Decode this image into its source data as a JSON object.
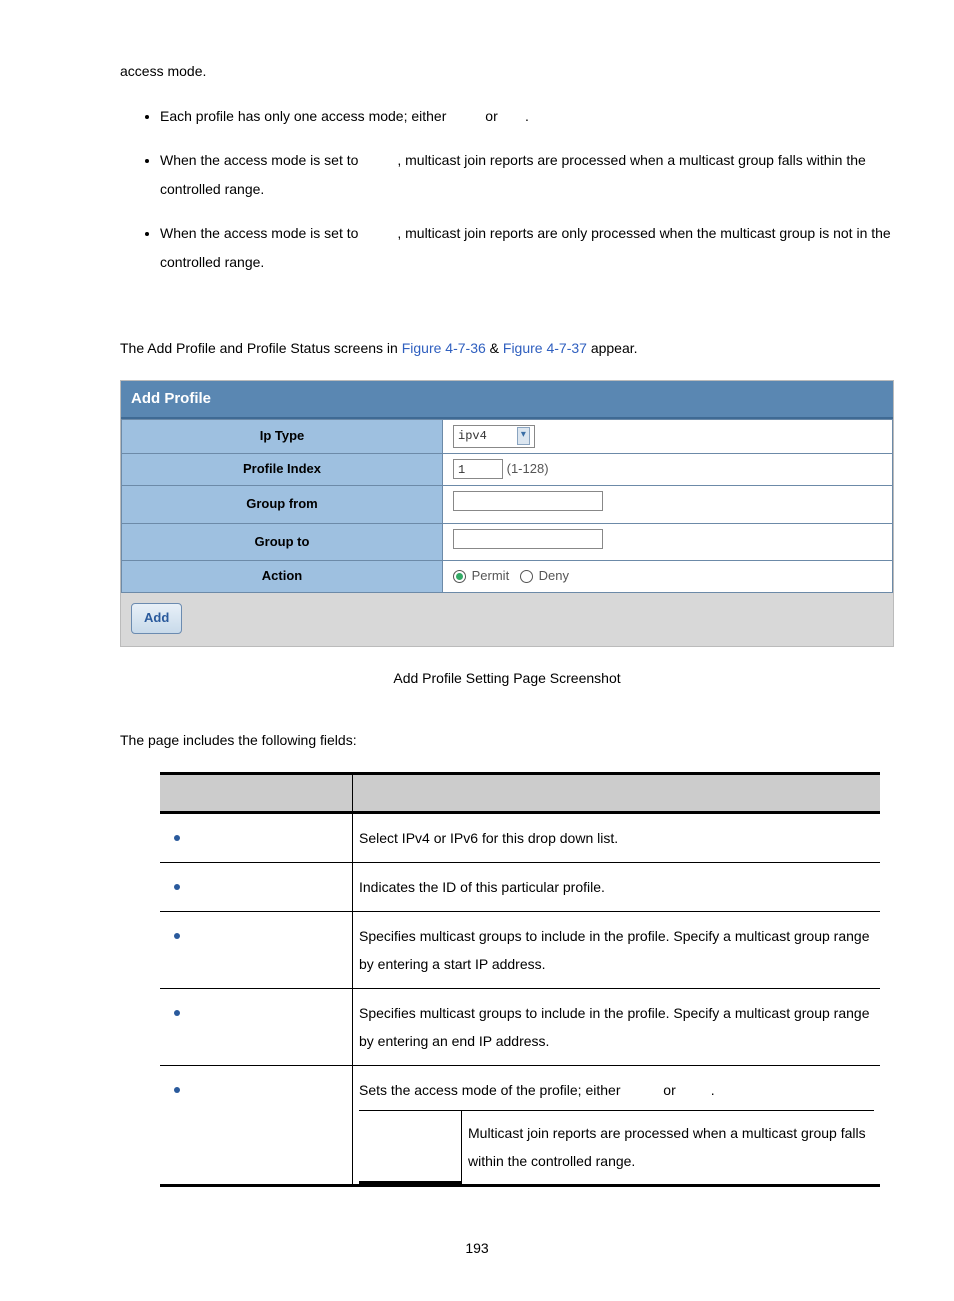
{
  "intro": {
    "line1": "access mode."
  },
  "bullets": {
    "b1_pre": "Each profile has only one access mode; either ",
    "b1_mid": "or",
    "b1_post": ".",
    "b2_pre": "When the access mode is set to ",
    "b2_post": ", multicast join reports are processed when a multicast group falls within the controlled range.",
    "b3_pre": "When the access mode is set to ",
    "b3_post": ", multicast join reports are only processed when the multicast group is not in the controlled range."
  },
  "paragraph2_pre": "The Add Profile and Profile Status screens in ",
  "fig1": "Figure 4-7-36",
  "amp": " & ",
  "fig2": "Figure 4-7-37",
  "paragraph2_post": " appear.",
  "panel": {
    "title": "Add Profile",
    "rows": {
      "iptype_label": "Ip Type",
      "iptype_value": "ipv4",
      "profileindex_label": "Profile Index",
      "profileindex_value": "1",
      "profileindex_hint": "(1-128)",
      "groupfrom_label": "Group from",
      "groupto_label": "Group to",
      "action_label": "Action",
      "action_permit": "Permit",
      "action_deny": "Deny"
    },
    "add_button": "Add"
  },
  "caption": "Add Profile Setting Page Screenshot",
  "fields_intro": "The page includes the following fields:",
  "table": {
    "rows": [
      {
        "desc": "Select IPv4 or IPv6 for this drop down list."
      },
      {
        "desc": "Indicates the ID of this particular profile."
      },
      {
        "desc": "Specifies multicast groups to include in the profile. Specify a multicast group range by entering a start IP address."
      },
      {
        "desc": "Specifies multicast groups to include in the profile. Specify a multicast group range by entering an end IP address."
      }
    ],
    "action_desc_pre": "Sets the access mode of the profile; either ",
    "action_desc_mid": "or",
    "action_desc_post": ".",
    "permit_desc": "Multicast join reports are processed when a multicast group falls within the controlled range."
  },
  "page_number": "193"
}
